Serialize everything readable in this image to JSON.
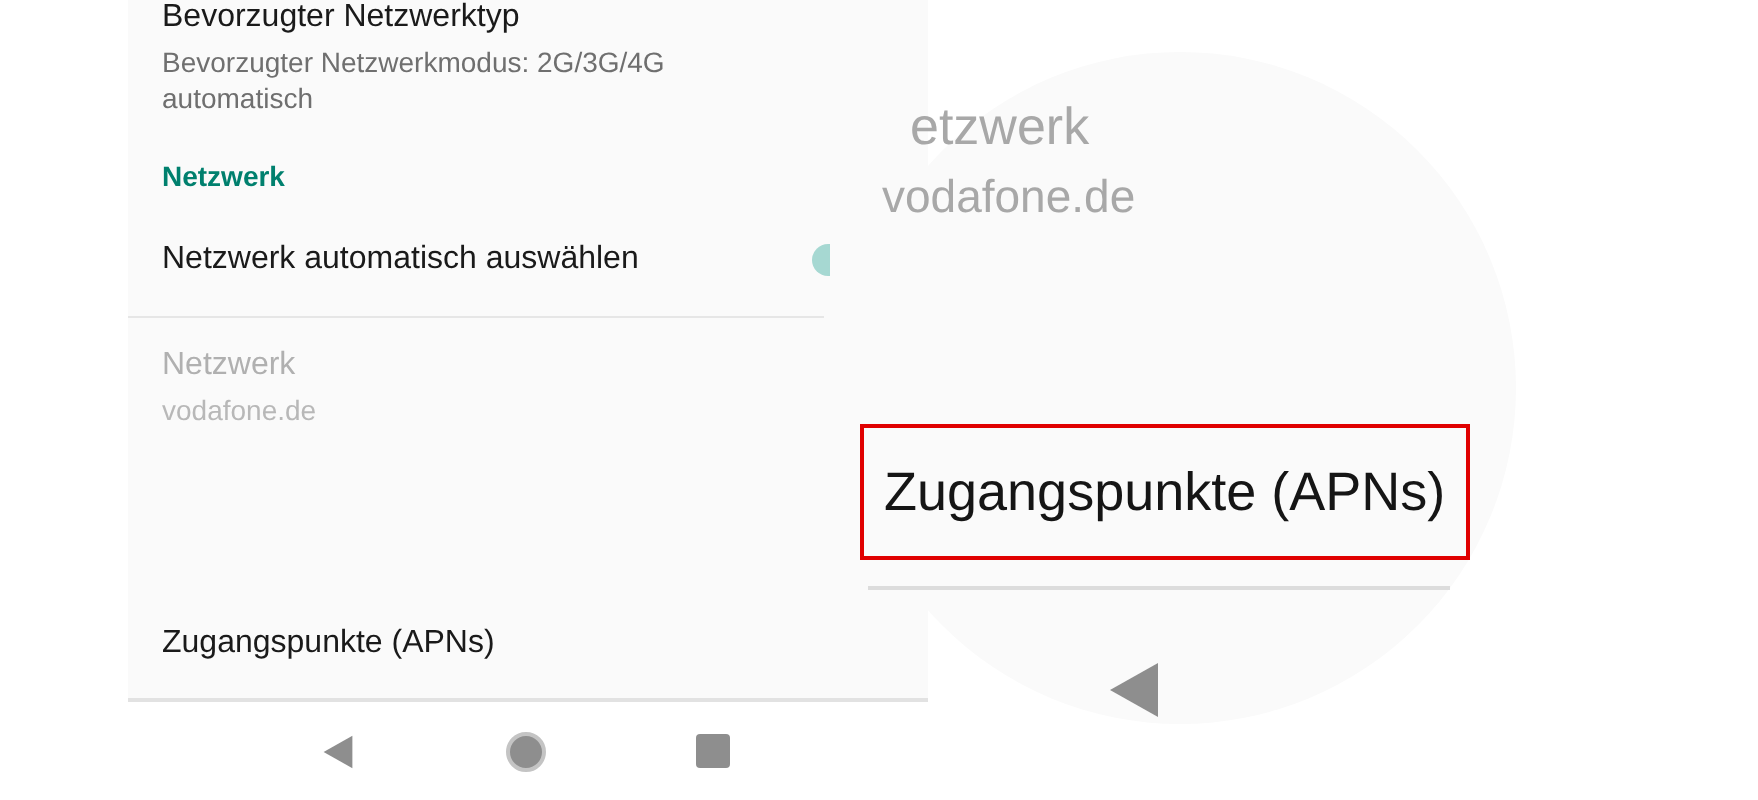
{
  "settings": [
    {
      "kind": "item",
      "title": "Bevorzugter Netzwerktyp",
      "summary": "Bevorzugter Netzwerkmodus: 2G/3G/4G automatisch",
      "disabled": false
    },
    {
      "kind": "header",
      "title": "Netzwerk"
    },
    {
      "kind": "switch",
      "title": "Netzwerk automatisch auswählen",
      "on": true
    },
    {
      "kind": "item",
      "title": "Netzwerk",
      "summary": "vodafone.de",
      "disabled": true
    },
    {
      "kind": "item",
      "title": "Zugangspunkte (APNs)",
      "disabled": false
    }
  ],
  "magnifier": {
    "title": "etzwerk",
    "summary": "vodafone.de",
    "highlight": "Zugangspunkte (APNs)"
  }
}
